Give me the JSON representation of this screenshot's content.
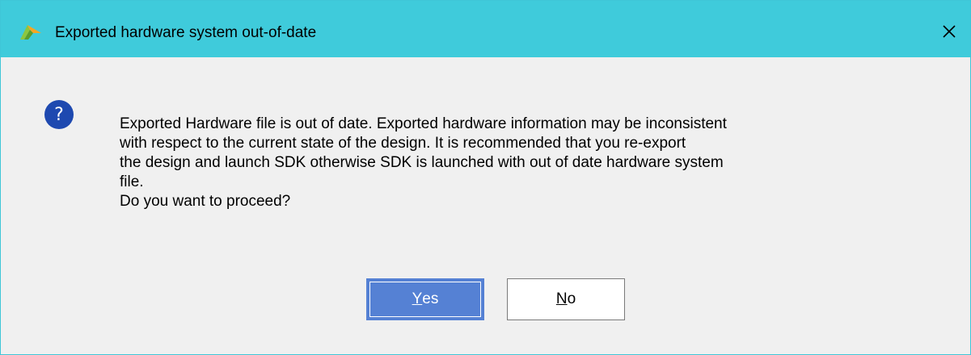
{
  "dialog": {
    "title": "Exported hardware system out-of-date",
    "message_lines": [
      "Exported Hardware file is out of date. Exported hardware information may be inconsistent",
      "with respect to the current state of the design. It is recommended that you re-export",
      "the design and launch SDK otherwise SDK is launched with out of date hardware system",
      "file.",
      "Do you want to proceed?"
    ],
    "icon": "question-icon",
    "icon_glyph": "?",
    "close_glyph": "✕",
    "buttons": {
      "yes": {
        "mnemonic": "Y",
        "rest": "es"
      },
      "no": {
        "mnemonic": "N",
        "rest": "o"
      }
    }
  },
  "colors": {
    "titlebar": "#3fcbdb",
    "background": "#f0f0f0",
    "primary_button": "#5581d4",
    "question_icon": "#1e49b0"
  }
}
